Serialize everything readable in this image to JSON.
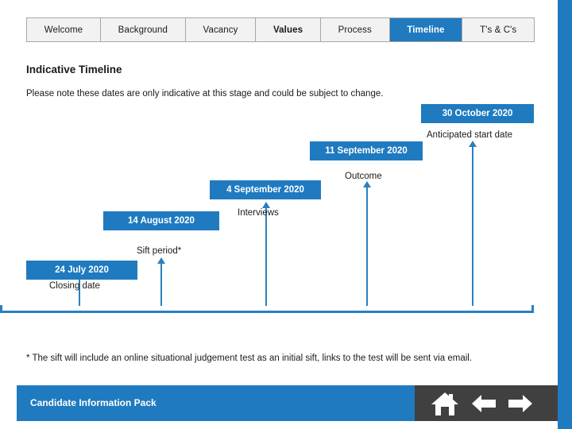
{
  "tabs": [
    {
      "label": "Welcome",
      "active": false,
      "bold": false
    },
    {
      "label": "Background",
      "active": false,
      "bold": false
    },
    {
      "label": "Vacancy",
      "active": false,
      "bold": false
    },
    {
      "label": "Values",
      "active": false,
      "bold": true
    },
    {
      "label": "Process",
      "active": false,
      "bold": false
    },
    {
      "label": "Timeline",
      "active": true,
      "bold": true
    },
    {
      "label": "T's & C's",
      "active": false,
      "bold": false
    }
  ],
  "section": {
    "title": "Indicative Timeline",
    "note": "Please note these dates are only indicative at this stage and could be subject to change."
  },
  "timeline": {
    "events": [
      {
        "date": "24 July 2020",
        "label": "Closing date"
      },
      {
        "date": "14 August 2020",
        "label": "Sift period*"
      },
      {
        "date": "4 September 2020",
        "label": ""
      },
      {
        "date": "11 September 2020",
        "label": "Interviews"
      },
      {
        "date": "30 October 2020",
        "label": "Outcome"
      },
      {
        "date": "",
        "label": "Anticipated start date"
      }
    ]
  },
  "footnote": "* The sift will include an online situational judgement test as an initial sift, links to the test will be sent via email.",
  "footer": {
    "title": "Candidate Information Pack",
    "icons": [
      "home-icon",
      "arrow-left-icon",
      "arrow-right-icon"
    ]
  },
  "colors": {
    "accent": "#1f7ac0",
    "line": "#2a7fbf",
    "footer_icons_bg": "#404040"
  }
}
